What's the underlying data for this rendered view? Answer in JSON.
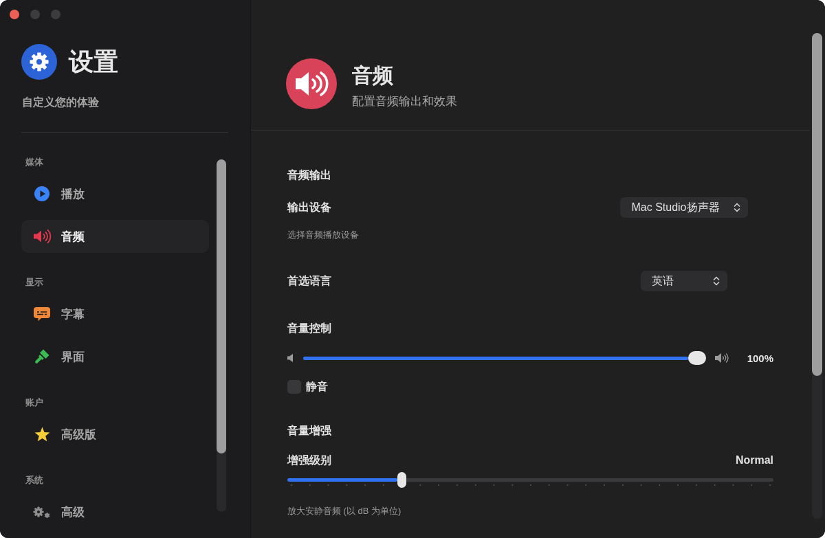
{
  "window": {
    "controls": [
      {
        "kind": "close",
        "disabled": false
      },
      {
        "kind": "minimize",
        "disabled": true
      },
      {
        "kind": "zoom",
        "disabled": true
      }
    ]
  },
  "sidebar": {
    "title": "设置",
    "subtitle": "自定义您的体验",
    "sections": [
      {
        "heading": "媒体",
        "items": [
          {
            "kind": "playback",
            "label": "播放",
            "selected": false
          },
          {
            "kind": "audio",
            "label": "音频",
            "selected": true
          }
        ]
      },
      {
        "heading": "显示",
        "items": [
          {
            "kind": "subtitles",
            "label": "字幕",
            "selected": false
          },
          {
            "kind": "interface",
            "label": "界面",
            "selected": false
          }
        ]
      },
      {
        "heading": "账户",
        "items": [
          {
            "kind": "premium",
            "label": "高级版",
            "selected": false
          }
        ]
      },
      {
        "heading": "系统",
        "items": [
          {
            "kind": "advanced",
            "label": "高级",
            "selected": false
          }
        ]
      }
    ]
  },
  "main": {
    "title": "音频",
    "subtitle": "配置音频输出和效果",
    "sections": [
      {
        "heading": "音频输出",
        "rows": [
          {
            "kind": "select",
            "label": "输出设备",
            "value": "Mac Studio扬声器",
            "hint": "选择音频播放设备"
          },
          {
            "kind": "select",
            "label": "首选语言",
            "value": "英语"
          }
        ]
      },
      {
        "heading": "音量控制",
        "rows": [
          {
            "kind": "volume",
            "level": 1,
            "reading": "100%"
          },
          {
            "kind": "checkbox",
            "label": "静音",
            "checked": false
          }
        ]
      },
      {
        "heading": "音量增强",
        "rows": [
          {
            "kind": "stepped-slider",
            "label": "增强级别",
            "reading": "Normal",
            "level": 0.235,
            "hint": "放大安静音频 (以 dB 为单位)"
          }
        ]
      }
    ]
  }
}
